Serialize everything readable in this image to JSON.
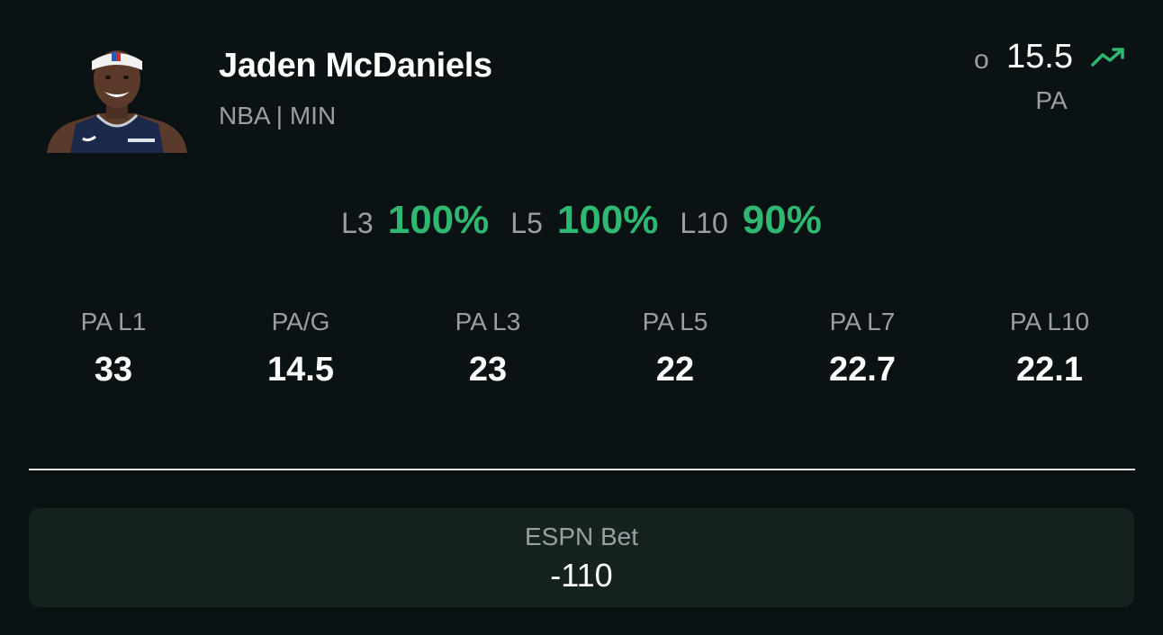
{
  "player": {
    "name": "Jaden McDaniels",
    "meta": "NBA | MIN"
  },
  "line": {
    "side": "o",
    "value": "15.5",
    "stat": "PA",
    "trend_icon": "trending-up-icon",
    "trend_color": "#2eb872"
  },
  "hit_rates": [
    {
      "label": "L3",
      "value": "100%"
    },
    {
      "label": "L5",
      "value": "100%"
    },
    {
      "label": "L10",
      "value": "90%"
    }
  ],
  "stats": [
    {
      "label": "PA L1",
      "value": "33"
    },
    {
      "label": "PA/G",
      "value": "14.5"
    },
    {
      "label": "PA L3",
      "value": "23"
    },
    {
      "label": "PA L5",
      "value": "22"
    },
    {
      "label": "PA L7",
      "value": "22.7"
    },
    {
      "label": "PA L10",
      "value": "22.1"
    }
  ],
  "book": {
    "name": "ESPN Bet",
    "odds": "-110"
  },
  "colors": {
    "background": "#0b1214",
    "accent_green": "#2eb872",
    "muted_text": "#9a9fa2",
    "card_bg": "#152220"
  }
}
